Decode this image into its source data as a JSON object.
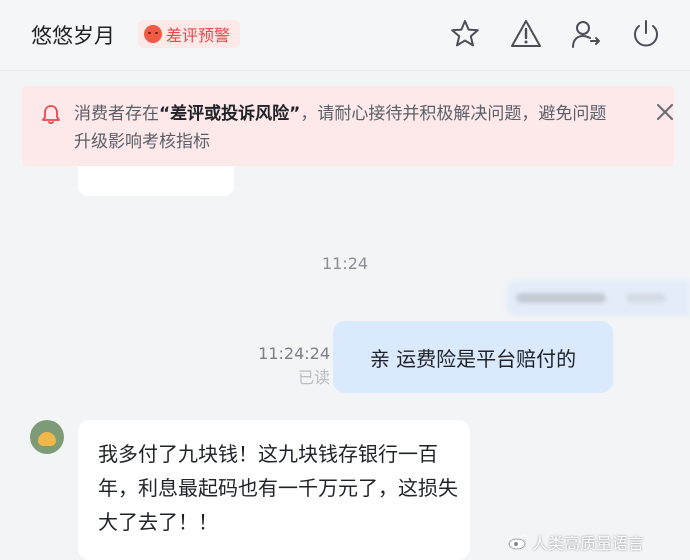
{
  "header": {
    "name": "悠悠岁月",
    "badge_label": "差评预警",
    "icons": [
      "star-icon",
      "warning-icon",
      "transfer-user-icon",
      "power-icon"
    ]
  },
  "alert": {
    "prefix": "消费者存在",
    "highlight": "“差评或投诉风险”",
    "suffix": "，请耐心接待并积极解决问题，避免问题升级影响考核指标"
  },
  "messages": {
    "time_1": "11:24",
    "sent_time": "11:24:24",
    "read_status": "已读",
    "sent_text": "亲 运费险是平台赔付的",
    "received_text": "我多付了九块钱！这九块钱存银行一百年，利息最起码也有一千万元了，这损失大了去了！！"
  },
  "watermark": {
    "text": "人类高质量语言"
  },
  "colors": {
    "alert_bg": "#fde9e9",
    "badge_text": "#e5484d",
    "sent_bubble": "#dbe9fd",
    "page_bg": "#f3f4f6"
  }
}
